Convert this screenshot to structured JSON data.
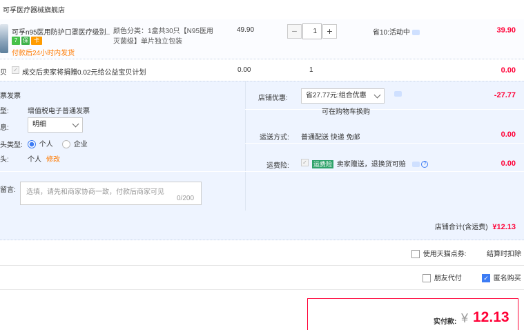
{
  "shop": {
    "name": "可孚医疗器械旗舰店"
  },
  "product": {
    "name": "可孚n95医用防护口罩医疗级别...",
    "badges": [
      "7",
      "保",
      "卡"
    ],
    "ship_note": "付款后24小时内发货",
    "spec_line1": "颜色分类：1盒共30只【N95医用",
    "spec_line2": "灭菌级】单片独立包装",
    "price": "49.90",
    "quantity": "1",
    "minus": "−",
    "plus": "+",
    "promo": "省10:活动中",
    "line_total": "39.90"
  },
  "donation": {
    "cut_label": "贝",
    "text": "成交后卖家将捐赠0.02元给公益宝贝计划",
    "price": "0.00",
    "qty": "1",
    "total": "0.00"
  },
  "invoice": {
    "title": "票发票",
    "type_label": "型:",
    "type_value": "增值税电子普通发票",
    "content_label": "息:",
    "content_value": "明细",
    "header_type_label": "头类型:",
    "opt_personal": "个人",
    "opt_company": "企业",
    "header_label": "头:",
    "header_value": "个人",
    "modify": "修改"
  },
  "message": {
    "label": "留言:",
    "placeholder": "选填，请先和商家协商一致，付款后商家可见",
    "counter": "0/200"
  },
  "store_discount": {
    "label": "店铺优惠:",
    "value": "省27.77元:组合优惠",
    "note": "可在购物车换购",
    "amount": "-27.77"
  },
  "shipping": {
    "label": "运送方式:",
    "value": "普通配送 快递 免邮",
    "amount": "0.00"
  },
  "insurance": {
    "label": "运费险:",
    "tag": "运费险",
    "text": "卖家赠送，退换货可赔",
    "amount": "0.00"
  },
  "shop_total": {
    "label": "店铺合计(含运费)",
    "amount": "¥12.13"
  },
  "points": {
    "label": "使用天猫点券:",
    "note": "结算时扣除"
  },
  "pay_options": {
    "friend_pay": "朋友代付",
    "anonymous": "匿名购买",
    "check": "✓"
  },
  "payment": {
    "label": "实付款:",
    "currency": "¥",
    "amount": "12.13"
  },
  "colors": {
    "accent": "#ff0036",
    "orange": "#ff7a00",
    "blue": "#3d7cf4",
    "panel": "#eef4ff"
  }
}
